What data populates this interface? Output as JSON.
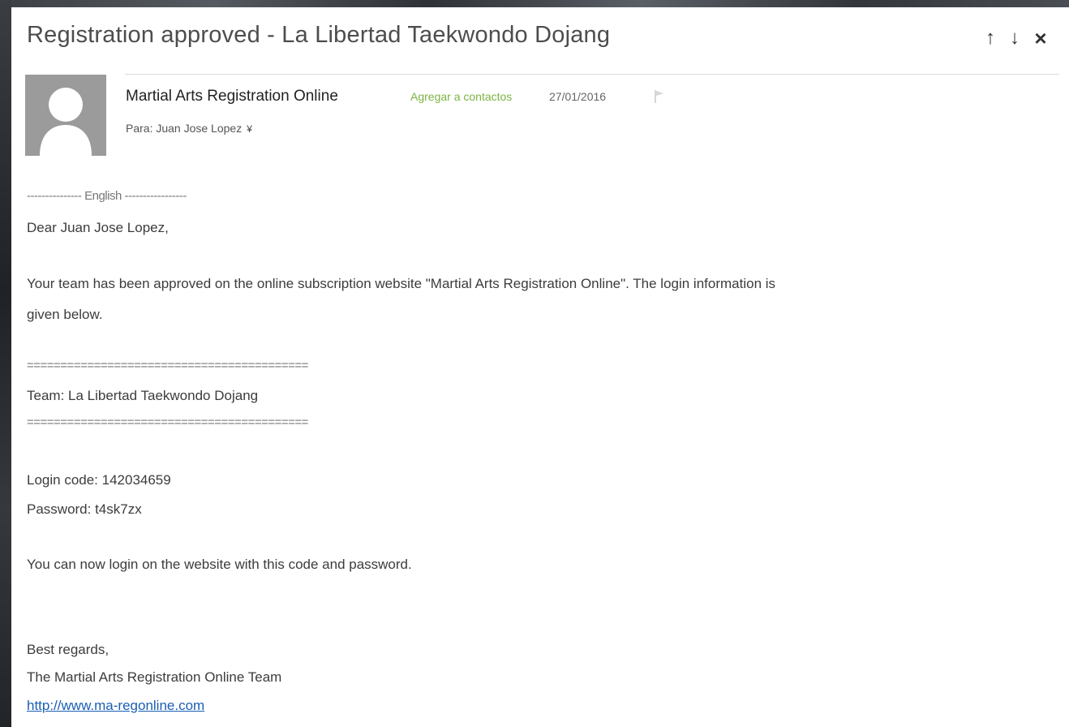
{
  "email": {
    "subject": "Registration approved - La Libertad Taekwondo Dojang",
    "nav": {
      "up": "↑",
      "down": "↓",
      "close": "×"
    },
    "sender": "Martial Arts Registration Online",
    "add_contact": "Agregar a contactos",
    "date": "27/01/2016",
    "to": "Para: Juan Jose Lopez",
    "to_toggle": "¥",
    "body": {
      "lang_header": "--------------- English -----------------",
      "greeting": "Dear Juan Jose Lopez,",
      "paragraph_line1": "Your team has been approved on the online subscription website \"Martial Arts Registration Online\". The login information is",
      "paragraph_line2": "given below.",
      "separator": "==========================================",
      "team": "Team: La Libertad Taekwondo Dojang",
      "login_code": "Login code: 142034659",
      "password": "Password: t4sk7zx",
      "instruction": "You can now login on the website with this code and password.",
      "closing": "Best regards,",
      "signature": "The Martial Arts Registration Online Team",
      "link": "http://www.ma-regonline.com"
    }
  },
  "colors": {
    "accent_green": "#7cb342",
    "link_blue": "#1a5fb4",
    "avatar_gray": "#9b9b9b"
  }
}
